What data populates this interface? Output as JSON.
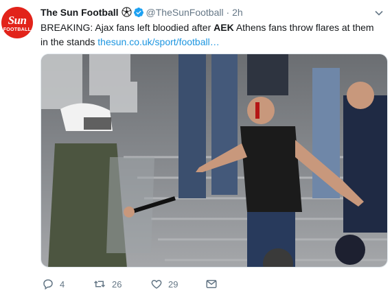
{
  "account": {
    "name": "The Sun Football",
    "emoji": "⚽",
    "handle": "@TheSunFootball",
    "separator": "·",
    "time": "2h",
    "avatar_text": "Sun",
    "avatar_subtext": "FOOTBALL"
  },
  "tweet": {
    "text_before": "BREAKING: Ajax fans left bloodied after ",
    "text_bold": "AEK",
    "text_after": " Athens fans throw flares at them in the stands ",
    "link": "thesun.co.uk/sport/football…"
  },
  "media": {
    "description_icon": "photo-crowd-clash"
  },
  "actions": {
    "replies": "4",
    "retweets": "26",
    "likes": "29"
  },
  "colors": {
    "brand_red": "#e2231a",
    "link_blue": "#1b95e0",
    "muted_gray": "#657786",
    "verified_blue": "#1da1f2"
  }
}
